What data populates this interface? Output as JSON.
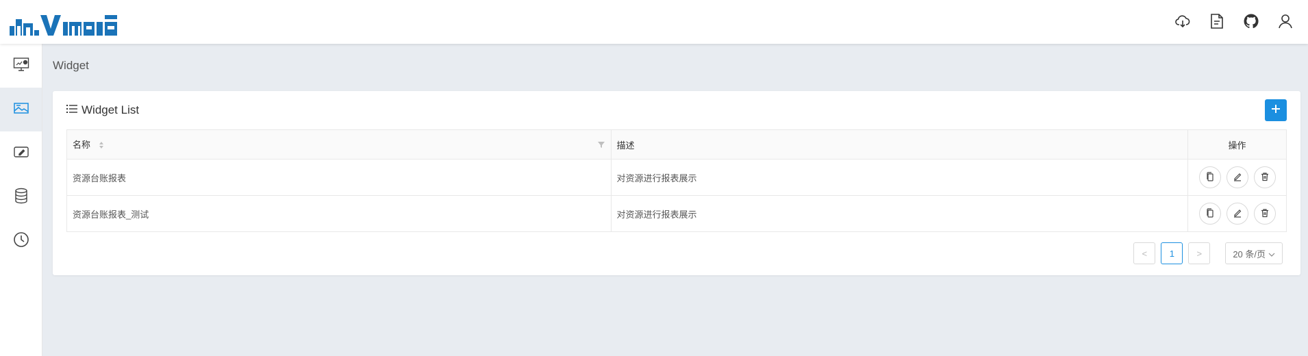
{
  "app": {
    "logo_text": "davinci"
  },
  "header": {
    "icons": [
      "cloud-download-icon",
      "document-icon",
      "github-icon",
      "user-icon"
    ]
  },
  "sidebar": {
    "items": [
      {
        "name": "dashboard-icon",
        "active": false
      },
      {
        "name": "widget-icon",
        "active": true
      },
      {
        "name": "edit-icon",
        "active": false
      },
      {
        "name": "database-icon",
        "active": false
      },
      {
        "name": "schedule-icon",
        "active": false
      }
    ]
  },
  "breadcrumb": "Widget",
  "card": {
    "title": "Widget List",
    "add_label": "+"
  },
  "table": {
    "columns": {
      "name": "名称",
      "description": "描述",
      "actions": "操作"
    },
    "rows": [
      {
        "name": "资源台账报表",
        "description": "对资源进行报表展示"
      },
      {
        "name": "资源台账报表_测试",
        "description": "对资源进行报表展示"
      }
    ]
  },
  "pagination": {
    "prev": "<",
    "current_page": "1",
    "next": ">",
    "page_size": "20 条/页"
  },
  "colors": {
    "accent": "#1b8fe0",
    "background": "#e8ecf1",
    "logo": "#1a73b8"
  }
}
